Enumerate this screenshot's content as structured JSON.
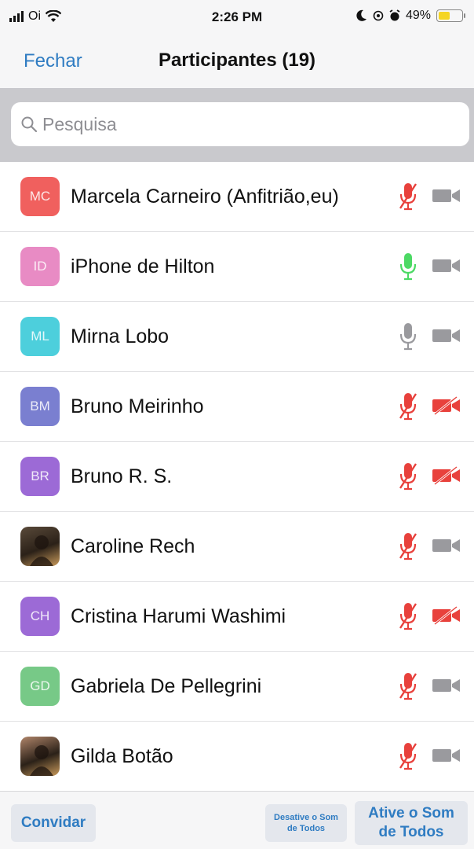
{
  "status_bar": {
    "carrier": "Oi",
    "time": "2:26 PM",
    "battery": "49%",
    "battery_level": 0.49
  },
  "nav": {
    "close_label": "Fechar",
    "title": "Participantes (19)"
  },
  "search": {
    "placeholder": "Pesquisa",
    "icon": "search-icon"
  },
  "participants": [
    {
      "initials": "MC",
      "name": "Marcela Carneiro (Anfitrião,eu)",
      "avatar_color": "#f0605e",
      "mic": "muted",
      "video": "off"
    },
    {
      "initials": "ID",
      "name": "iPhone de Hilton",
      "avatar_color": "#e88bc4",
      "mic": "speaking",
      "video": "off"
    },
    {
      "initials": "ML",
      "name": "Mirna Lobo",
      "avatar_color": "#4dcfdc",
      "mic": "unmuted",
      "video": "off"
    },
    {
      "initials": "BM",
      "name": "Bruno Meirinho",
      "avatar_color": "#7a7fd0",
      "mic": "muted",
      "video": "stopped"
    },
    {
      "initials": "BR",
      "name": "Bruno R. S.",
      "avatar_color": "#9c6ad6",
      "mic": "muted",
      "video": "stopped"
    },
    {
      "initials": "",
      "name": "Caroline Rech",
      "avatar_color": "#5a4a3a",
      "mic": "muted",
      "video": "off",
      "photo": true
    },
    {
      "initials": "CH",
      "name": "Cristina Harumi Washimi",
      "avatar_color": "#9c6ad6",
      "mic": "muted",
      "video": "stopped"
    },
    {
      "initials": "GD",
      "name": "Gabriela De Pellegrini",
      "avatar_color": "#77c987",
      "mic": "muted",
      "video": "off"
    },
    {
      "initials": "",
      "name": "Gilda Botão",
      "avatar_color": "#b0856a",
      "mic": "muted",
      "video": "off",
      "photo": true
    }
  ],
  "bottom_bar": {
    "invite_label": "Convidar",
    "mute_all_label": "Desative o Som de Todos",
    "unmute_all_label": "Ative o Som de Todos"
  },
  "colors": {
    "accent": "#2f7cc2",
    "muted_red": "#e8413c",
    "speaking_green": "#4cd964",
    "icon_gray": "#9a9a9e"
  }
}
